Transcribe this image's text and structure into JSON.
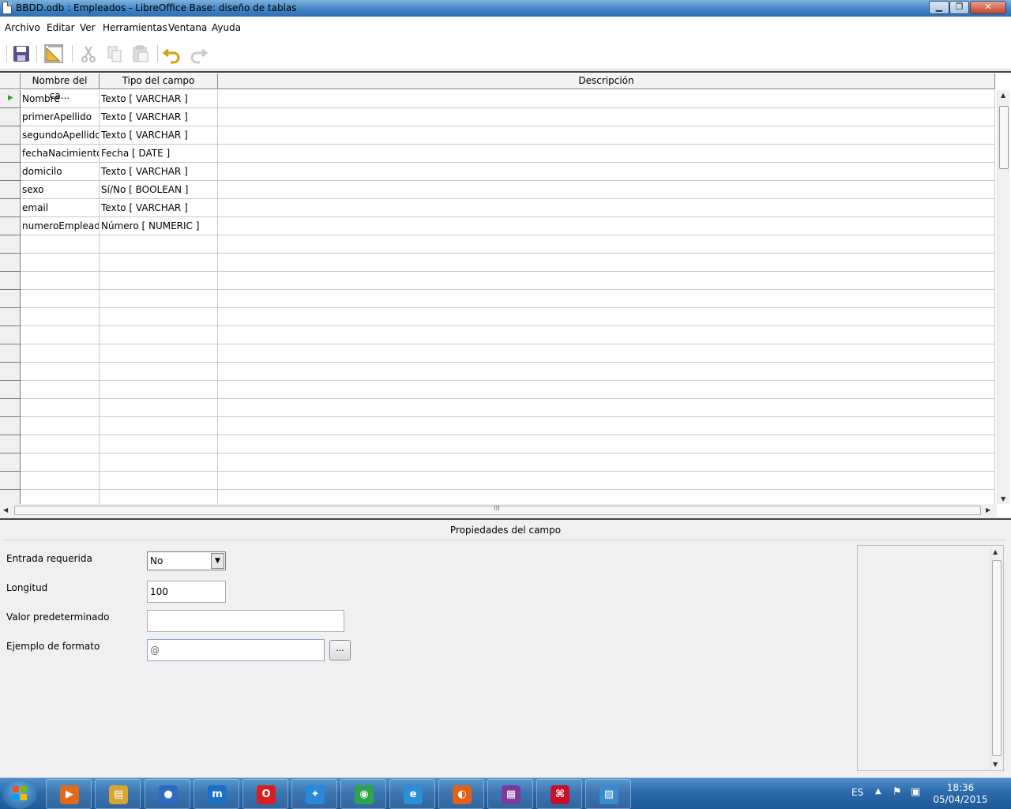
{
  "window": {
    "title": "BBDD.odb : Empleados - LibreOffice Base: diseño de tablas",
    "min_glyph": "▁",
    "max_glyph": "❐",
    "close_glyph": "✕"
  },
  "menu": [
    "Archivo",
    "Editar",
    "Ver",
    "Herramientas",
    "Ventana",
    "Ayuda"
  ],
  "toolbar": {
    "icons": [
      "save-icon",
      "index-design-icon",
      "cut-icon",
      "copy-icon",
      "paste-icon",
      "undo-icon",
      "redo-icon"
    ]
  },
  "table": {
    "columns": [
      "Nombre del ca...",
      "Tipo del campo",
      "Descripción"
    ],
    "rows": [
      {
        "name": "Nombre",
        "type": "Texto [ VARCHAR ]",
        "desc": ""
      },
      {
        "name": "primerApellido",
        "type": "Texto [ VARCHAR ]",
        "desc": ""
      },
      {
        "name": "segundoApellido",
        "type": "Texto [ VARCHAR ]",
        "desc": ""
      },
      {
        "name": "fechaNacimiento",
        "type": "Fecha [ DATE ]",
        "desc": ""
      },
      {
        "name": "domicilo",
        "type": "Texto [ VARCHAR ]",
        "desc": ""
      },
      {
        "name": "sexo",
        "type": "Sí/No [ BOOLEAN ]",
        "desc": ""
      },
      {
        "name": "email",
        "type": "Texto [ VARCHAR ]",
        "desc": ""
      },
      {
        "name": "numeroEmpleado",
        "type": "Número [ NUMERIC ]",
        "desc": ""
      }
    ],
    "current_row_marker": "▶",
    "hscroll_grip": "III"
  },
  "properties": {
    "title": "Propiedades del campo",
    "required_label": "Entrada requerida",
    "required_value": "No",
    "length_label": "Longitud",
    "length_value": "100",
    "default_label": "Valor predeterminado",
    "default_value": "",
    "format_label": "Ejemplo de formato",
    "format_value": "@",
    "format_button": "..."
  },
  "taskbar": {
    "apps": [
      "media-player-icon",
      "file-explorer-icon",
      "google-earth-icon",
      "maxthon-icon",
      "opera-icon",
      "safari-icon",
      "chrome-icon",
      "internet-explorer-icon",
      "firefox-icon",
      "libreoffice-base-icon",
      "acrobat-icon",
      "image-viewer-icon"
    ],
    "language": "ES",
    "time": "18:36",
    "date": "05/04/2015"
  }
}
